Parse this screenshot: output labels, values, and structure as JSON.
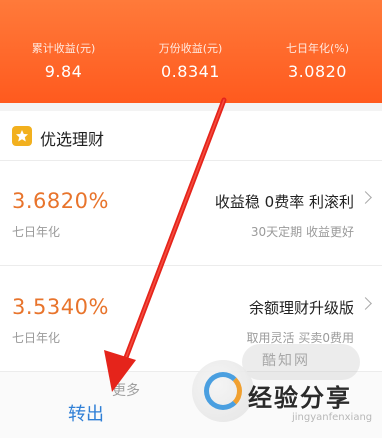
{
  "header": {
    "stats": [
      {
        "label": "累计收益(元)",
        "value": "9.84"
      },
      {
        "label": "万份收益(元)",
        "value": "0.8341"
      },
      {
        "label": "七日年化(%)",
        "value": "3.0820"
      }
    ]
  },
  "section": {
    "title": "优选理财",
    "icon": "star-badge-icon"
  },
  "products": [
    {
      "rate": "3.6820%",
      "rate_label": "七日年化",
      "title": "收益稳 0费率 利滚利",
      "subtitle": "30天定期 收益更好"
    },
    {
      "rate": "3.5340%",
      "rate_label": "七日年化",
      "title": "余额理财升级版",
      "subtitle": "取用灵活 买卖0费用"
    }
  ],
  "bottom": {
    "partial_text": "更多",
    "transfer_label": "转出"
  },
  "watermark": {
    "cloud": "酷知网",
    "text": "经验分享",
    "sub": "jingyanfenxiang"
  },
  "colors": {
    "header": "#ff5a1e",
    "rate": "#e8742c",
    "link": "#2f7fd6",
    "annotation_arrow": "#e5241b"
  }
}
